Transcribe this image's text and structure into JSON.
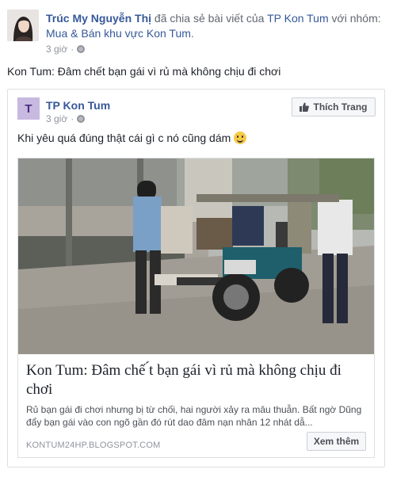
{
  "post": {
    "author": "Trúc My Nguyễn Thị",
    "action_text": "đã chia sẻ bài viết của",
    "shared_page": "TP Kon Tum",
    "with_text": "với nhóm:",
    "group": "Mua & Bán khu vực Kon Tum",
    "punctuation": ".",
    "time": "3 giờ",
    "separator": "·",
    "status_text": "Kon Tum: Đâm chết bạn gái vì rủ mà không chịu đi chơi"
  },
  "shared_post": {
    "page_initial": "T",
    "page_name": "TP Kon Tum",
    "time": "3 giờ",
    "separator": "·",
    "like_button_label": "Thích Trang",
    "text": "Khi yêu quá đúng thật cái gì c nó cũng dám"
  },
  "link_preview": {
    "title": "Kon Tum: Đâm chế ́t bạn gái vì rủ mà không chịu đi chơi",
    "description": "Rủ bạn gái đi chơi nhưng bị từ chối, hai người xảy ra mâu thuẫn. Bất ngờ Dũng đẩy bạn gái vào con ngõ gần đó rút dao đâm nạn nhân 12 nhát dẫ...",
    "domain": "KONTUM24HP.BLOGSPOT.COM",
    "see_more_label": "Xem thêm"
  },
  "colors": {
    "link_blue": "#365899",
    "meta_gray": "#90949c",
    "border": "#dddfe2"
  },
  "icons": [
    "globe-icon",
    "thumbs-up-icon",
    "smiley-emoji-icon"
  ]
}
